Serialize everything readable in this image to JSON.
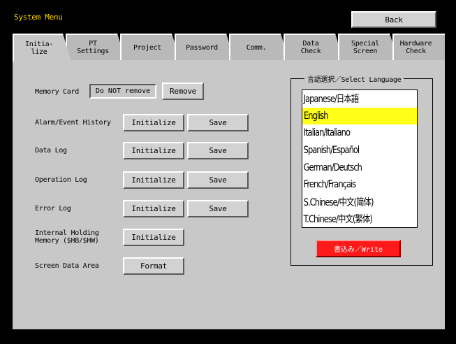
{
  "header": {
    "title": "System Menu",
    "back_label": "Back"
  },
  "tabs": [
    {
      "label": "Initia-\nlize",
      "active": true
    },
    {
      "label": "PT\nSettings",
      "active": false
    },
    {
      "label": "Project",
      "active": false
    },
    {
      "label": "Password",
      "active": false
    },
    {
      "label": "Comm.",
      "active": false
    },
    {
      "label": "Data\nCheck",
      "active": false
    },
    {
      "label": "Special\nScreen",
      "active": false
    },
    {
      "label": "Hardware\nCheck",
      "active": false
    }
  ],
  "initialize": {
    "memory_card": {
      "label": "Memory Card",
      "status": "Do NOT remove",
      "remove_label": "Remove"
    },
    "alarm_event_history": {
      "label": "Alarm/Event History",
      "initialize_label": "Initialize",
      "save_label": "Save"
    },
    "data_log": {
      "label": "Data Log",
      "initialize_label": "Initialize",
      "save_label": "Save"
    },
    "operation_log": {
      "label": "Operation Log",
      "initialize_label": "Initialize",
      "save_label": "Save"
    },
    "error_log": {
      "label": "Error Log",
      "initialize_label": "Initialize",
      "save_label": "Save"
    },
    "internal_holding_memory": {
      "label_line1": "Internal Holding",
      "label_line2": "Memory ($HB/$HW)",
      "initialize_label": "Initialize"
    },
    "screen_data_area": {
      "label": "Screen Data Area",
      "format_label": "Format"
    }
  },
  "language": {
    "group_title": "言語選択／Select Language",
    "options": [
      "Japanese/日本語",
      "English",
      "Italian/Italiano",
      "Spanish/Español",
      "German/Deutsch",
      "French/Français",
      "S.Chinese/中文(简体)",
      "T.Chinese/中文(繁体)"
    ],
    "selected": "English",
    "write_label": "書込み／Write"
  },
  "colors": {
    "title_text": "#ffd400",
    "panel": "#c8c8c8",
    "selection": "#ffff1a",
    "write_button": "#ff1a1a"
  }
}
